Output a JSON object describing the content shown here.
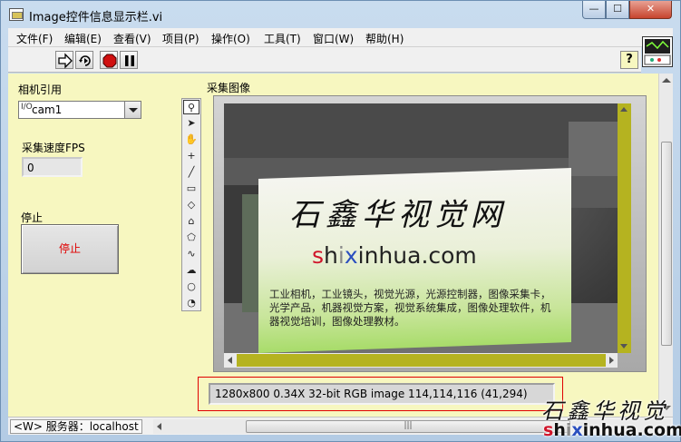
{
  "window": {
    "title": "Image控件信息显示栏.vi",
    "min_glyph": "—",
    "max_glyph": "☐",
    "close_glyph": "✕"
  },
  "menu": {
    "items": [
      "文件(F)",
      "编辑(E)",
      "查看(V)",
      "项目(P)",
      "操作(O)",
      "工具(T)",
      "窗口(W)",
      "帮助(H)"
    ]
  },
  "toolbar": {
    "buttons": [
      "run-arrow-icon",
      "run-continuously-icon",
      "abort-icon",
      "pause-icon"
    ],
    "help_label": "?"
  },
  "panel": {
    "camera_label": "相机引用",
    "camera_value": "cam1",
    "camera_io_glyph": "I/O",
    "fps_label": "采集速度FPS",
    "fps_value": "0",
    "stop_label": "停止",
    "stop_button_text": "停止",
    "image_label": "采集图像",
    "image_info": "1280x800 0.34X 32-bit RGB image 114,114,116     (41,294)"
  },
  "image_content": {
    "card_logo": "石鑫华视觉网",
    "card_url_s": "s",
    "card_url_h": "h",
    "card_url_i": "i",
    "card_url_x": "x",
    "card_url_rest": "inhua.com",
    "card_desc": "工业相机，工业镜头，视觉光源，光源控制器，图像采集卡，光学产品，机器视觉方案，视觉系统集成，图像处理软件，机器视觉培训，图像处理教材。"
  },
  "status": {
    "target": "<W> 服务器：localhost",
    "scroll_grip": "|||"
  },
  "watermark": {
    "logo": "石鑫华视觉",
    "url_s": "s",
    "url_h": "h",
    "url_i": "i",
    "url_x": "x",
    "url_rest": "inhua.com"
  },
  "colors": {
    "panel_bg": "#f7f7c0",
    "scroll_accent": "#b5b320",
    "stop_text": "#e00000",
    "highlight_outline": "#e00000"
  }
}
